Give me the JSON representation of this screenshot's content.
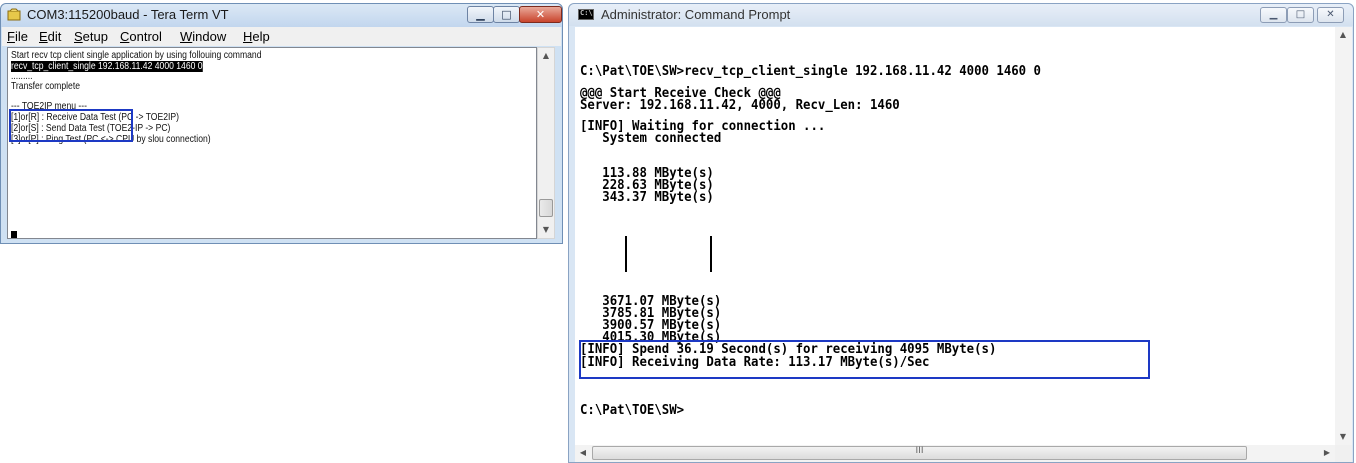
{
  "teraterm": {
    "title": "COM3:115200baud - Tera Term VT",
    "menu": [
      {
        "u": "F",
        "rest": "ile"
      },
      {
        "u": "E",
        "rest": "dit"
      },
      {
        "u": "S",
        "rest": "etup"
      },
      {
        "u": "C",
        "rest": "ontrol",
        "prefix": ""
      },
      {
        "u": "W",
        "rest": "indow"
      },
      {
        "u": "H",
        "rest": "elp"
      }
    ],
    "lines": [
      "Start recv tcp client single application by using follouing command",
      "recv_tcp_client_single 192.168.11.42 4000 1460 0",
      ".........",
      "Transfer complete",
      "--- TOE2IP menu ---",
      "[1]or[R] : Receive Data Test (PC -> TOE2IP)",
      "[2]or[S] : Send Data Test (TOE2-IP -> PC)",
      "[3]or[P] : Ping Test (PC <-> CPU by slou connection)"
    ]
  },
  "cmd": {
    "title": "Administrator: Command Prompt",
    "lines": [
      "C:\\Pat\\TOE\\SW>recv_tcp_client_single 192.168.11.42 4000 1460 0",
      "@@@ Start Receive Check @@@",
      "Server: 192.168.11.42, 4000, Recv_Len: 1460",
      "[INFO] Waiting for connection ...",
      "   System connected",
      "   113.88 MByte(s)",
      "   228.63 MByte(s)",
      "   343.37 MByte(s)",
      "   3671.07 MByte(s)",
      "   3785.81 MByte(s)",
      "   3900.57 MByte(s)",
      "   4015.30 MByte(s)",
      "[INFO] Spend 36.19 Second(s) for receiving 4095 MByte(s)",
      "[INFO] Receiving Data Rate: 113.17 MByte(s)/Sec",
      "C:\\Pat\\TOE\\SW>"
    ],
    "hscroll_grip": "III"
  }
}
